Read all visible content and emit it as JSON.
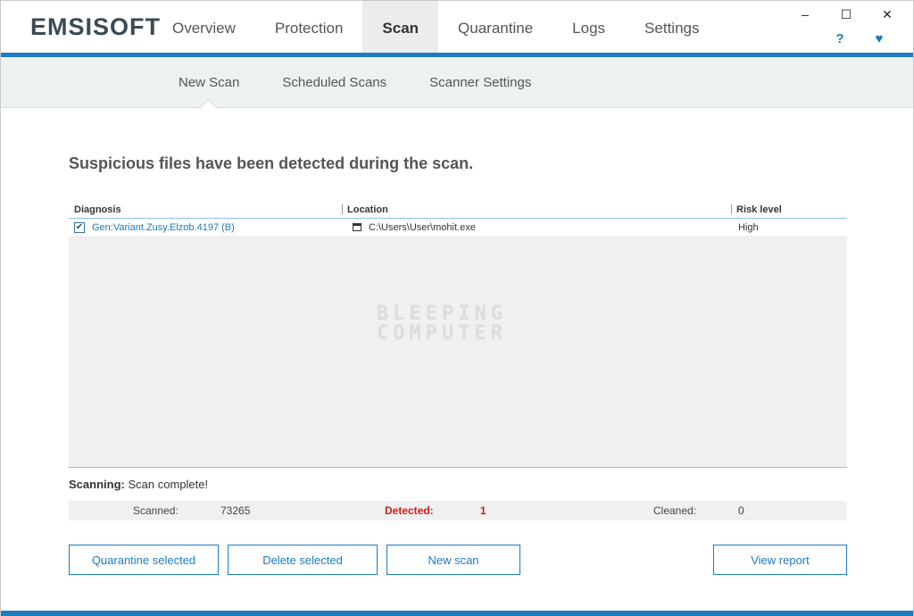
{
  "app": {
    "logo": "EMSISOFT"
  },
  "nav": {
    "tabs": [
      {
        "label": "Overview"
      },
      {
        "label": "Protection"
      },
      {
        "label": "Scan",
        "active": true
      },
      {
        "label": "Quarantine"
      },
      {
        "label": "Logs"
      },
      {
        "label": "Settings"
      }
    ]
  },
  "window_controls": {
    "minimize": "–",
    "maximize": "☐",
    "close": "✕",
    "help": "?",
    "heart": "♥"
  },
  "subnav": {
    "tabs": [
      {
        "label": "New Scan",
        "active": true
      },
      {
        "label": "Scheduled Scans"
      },
      {
        "label": "Scanner Settings"
      }
    ]
  },
  "main": {
    "heading": "Suspicious files have been detected during the scan.",
    "columns": {
      "diagnosis": "Diagnosis",
      "location": "Location",
      "risk": "Risk level"
    },
    "rows": [
      {
        "checked": true,
        "diagnosis": "Gen:Variant.Zusy.Elzob.4197 (B)",
        "location": "C:\\Users\\User\\mohit.exe",
        "risk": "High"
      }
    ],
    "watermark": {
      "line1": "BLEEPING",
      "line2": "COMPUTER"
    },
    "status": {
      "label": "Scanning:",
      "value": "Scan complete!"
    },
    "stats": {
      "scanned_label": "Scanned:",
      "scanned_value": "73265",
      "detected_label": "Detected:",
      "detected_value": "1",
      "cleaned_label": "Cleaned:",
      "cleaned_value": "0"
    },
    "buttons": {
      "quarantine": "Quarantine selected",
      "delete": "Delete selected",
      "new_scan": "New scan",
      "view_report": "View report"
    }
  },
  "colors": {
    "accent": "#1c7bc1",
    "danger": "#d11818"
  }
}
